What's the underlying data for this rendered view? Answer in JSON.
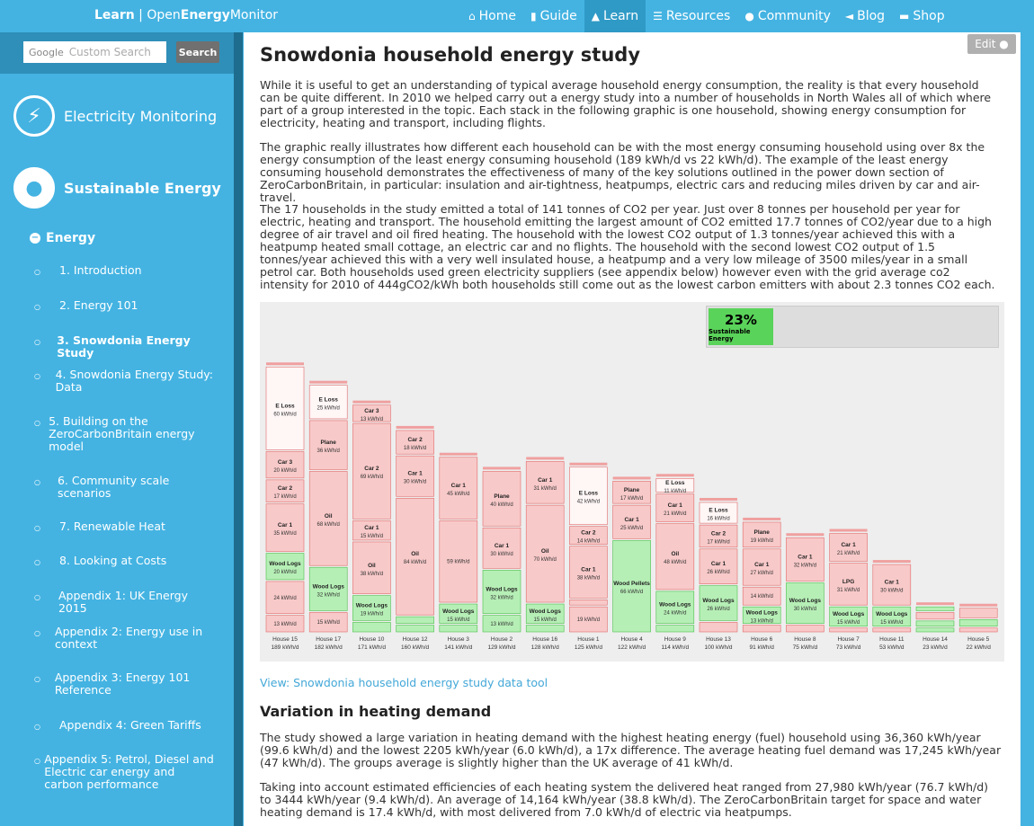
{
  "brand": {
    "learn": "Learn",
    "sep": " | ",
    "open": "Open",
    "energy": "Energy",
    "monitor": "Monitor"
  },
  "nav": [
    {
      "icon": "home-icon",
      "label": "Home",
      "active": false
    },
    {
      "icon": "book-icon",
      "label": "Guide",
      "active": false
    },
    {
      "icon": "graduation-cap-icon",
      "label": "Learn",
      "active": true
    },
    {
      "icon": "list-icon",
      "label": "Resources",
      "active": false
    },
    {
      "icon": "comments-icon",
      "label": "Community",
      "active": false
    },
    {
      "icon": "bullhorn-icon",
      "label": "Blog",
      "active": false
    },
    {
      "icon": "cart-icon",
      "label": "Shop",
      "active": false
    }
  ],
  "search": {
    "google": "Google",
    "placeholder": "Custom Search",
    "button": "Search"
  },
  "sidebar": {
    "cat1": "Electricity Monitoring",
    "cat2": "Sustainable Energy",
    "section": "Energy",
    "items": [
      {
        "label": "1. Introduction"
      },
      {
        "label": "2. Energy 101"
      },
      {
        "label": "3. Snowdonia Energy Study"
      },
      {
        "label": "4. Snowdonia Energy Study: Data"
      },
      {
        "label": "5. Building on the ZeroCarbonBritain energy model"
      },
      {
        "label": "6. Community scale scenarios"
      },
      {
        "label": "7. Renewable Heat"
      },
      {
        "label": "8. Looking at Costs"
      },
      {
        "label": "Appendix 1: UK Energy 2015"
      },
      {
        "label": "Appendix 2: Energy use in context"
      },
      {
        "label": "Appendix 3: Energy 101 Reference"
      },
      {
        "label": "Appendix 4: Green Tariffs"
      },
      {
        "label": "Appendix 5: Petrol, Diesel and Electric car energy and carbon performance"
      }
    ]
  },
  "edit": "Edit",
  "title": "Snowdonia household energy study",
  "p1": "While it is useful to get an understanding of typical average household energy consumption, the reality is that every household can be quite different. In 2010 we helped carry out a energy study into a number of households in North Wales all of which where part of a group interested in the topic. Each stack in the following graphic is one household, showing energy consumption for electricity, heating and transport, including flights.",
  "p2": "The graphic really illustrates how different each household can be with the most energy consuming household using over 8x the energy consumption of the least energy consuming household (189 kWh/d vs 22 kWh/d). The example of the least energy consuming household demonstrates the effectiveness of many of the key solutions outlined in the power down section of ZeroCarbonBritain, in particular: insulation and air-tightness, heatpumps, electric cars and reducing miles driven by car and air-travel.",
  "p3": "The 17 households in the study emitted a total of 141 tonnes of CO2 per year. Just over 8 tonnes per household per year for electric, heating and transport. The household emitting the largest amount of CO2 emitted 17.7 tonnes of CO2/year due to a high degree of air travel and oil fired heating. The household with the lowest CO2 output of 1.3 tonnes/year achieved this with a heatpump heated small cottage, an electric car and no flights. The household with the second lowest CO2 output of 1.5 tonnes/year achieved this with a very well insulated house, a heatpump and a very low mileage of 3500 miles/year in a small petrol car. Both households used green electricity suppliers (see appendix below) however even with the grid average co2 intensity for 2010 of 444gCO2/kWh both households still come out as the lowest carbon emitters with about 2.3 tonnes CO2 each.",
  "datalink": "View: Snowdonia household energy study data tool",
  "h2": "Variation in heating demand",
  "p4": "The study showed a large variation in heating demand with the highest heating energy (fuel) household using 36,360 kWh/year (99.6 kWh/d) and the lowest 2205 kWh/year (6.0 kWh/d), a 17x difference. The average heating fuel demand was 17,245 kWh/year (47 kWh/d). The groups average is slightly higher than the UK average of 41 kWh/d.",
  "p5": "Taking into account estimated efficiencies of each heating system the delivered heat ranged from 27,980 kWh/year (76.7 kWh/d) to 3444 kWh/year (9.4 kWh/d). An average of 14,164 kWh/year (38.8 kWh/d). The ZeroCarbonBritain target for space and water heating demand is 17.4 kWh/d, with most delivered from 7.0 kWh/d of electric via heatpumps.",
  "sustainable": {
    "pct": "23%",
    "label": "Sustainable Energy",
    "fraction": 0.23
  },
  "colors": {
    "red": "#f8c9c9",
    "redborder": "#e26b6b",
    "green": "#b6efb6",
    "greenborder": "#4cbf4c",
    "white": "#fff6f6",
    "top": "#f0a0a0"
  },
  "chart_data": {
    "type": "bar",
    "unit": "kWh/d",
    "households": [
      {
        "name": "House 15",
        "total": "189 kWh/d",
        "total_val": 189,
        "segs": [
          {
            "l": "",
            "v": "13 kWh/d",
            "n": 13,
            "c": "r"
          },
          {
            "l": "",
            "v": "24 kWh/d",
            "n": 24,
            "c": "r"
          },
          {
            "l": "Wood Logs",
            "v": "20 kWh/d",
            "n": 20,
            "c": "g"
          },
          {
            "l": "Car 1",
            "v": "35 kWh/d",
            "n": 35,
            "c": "r"
          },
          {
            "l": "Car 2",
            "v": "17 kWh/d",
            "n": 17,
            "c": "r"
          },
          {
            "l": "Car 3",
            "v": "20 kWh/d",
            "n": 20,
            "c": "r"
          },
          {
            "l": "E Loss",
            "v": "60 kWh/d",
            "n": 60,
            "c": "w"
          }
        ]
      },
      {
        "name": "House 17",
        "total": "182 kWh/d",
        "total_val": 182,
        "segs": [
          {
            "l": "",
            "v": "15 kWh/d",
            "n": 15,
            "c": "r"
          },
          {
            "l": "Wood Logs",
            "v": "32 kWh/d",
            "n": 32,
            "c": "g"
          },
          {
            "l": "Oil",
            "v": "68 kWh/d",
            "n": 68,
            "c": "r"
          },
          {
            "l": "Plane",
            "v": "36 kWh/d",
            "n": 36,
            "c": "r"
          },
          {
            "l": "E Loss",
            "v": "25 kWh/d",
            "n": 25,
            "c": "w"
          }
        ]
      },
      {
        "name": "House 10",
        "total": "171 kWh/d",
        "total_val": 171,
        "segs": [
          {
            "l": "",
            "v": "",
            "n": 8,
            "c": "g"
          },
          {
            "l": "Wood Logs",
            "v": "19 kWh/d",
            "n": 19,
            "c": "g"
          },
          {
            "l": "Oil",
            "v": "38 kWh/d",
            "n": 38,
            "c": "r"
          },
          {
            "l": "Car 1",
            "v": "15 kWh/d",
            "n": 15,
            "c": "r"
          },
          {
            "l": "Car 2",
            "v": "69 kWh/d",
            "n": 69,
            "c": "r"
          },
          {
            "l": "Car 3",
            "v": "13 kWh/d",
            "n": 13,
            "c": "r"
          }
        ]
      },
      {
        "name": "House 12",
        "total": "160 kWh/d",
        "total_val": 160,
        "segs": [
          {
            "l": "",
            "v": "",
            "n": 6,
            "c": "g"
          },
          {
            "l": "",
            "v": "",
            "n": 6,
            "c": "g"
          },
          {
            "l": "Oil",
            "v": "84 kWh/d",
            "n": 84,
            "c": "r"
          },
          {
            "l": "Car 1",
            "v": "30 kWh/d",
            "n": 30,
            "c": "r"
          },
          {
            "l": "Car 2",
            "v": "18 kWh/d",
            "n": 18,
            "c": "r"
          }
        ]
      },
      {
        "name": "House 3",
        "total": "141 kWh/d",
        "total_val": 141,
        "segs": [
          {
            "l": "",
            "v": "",
            "n": 6,
            "c": "g"
          },
          {
            "l": "Wood Logs",
            "v": "15 kWh/d",
            "n": 15,
            "c": "g"
          },
          {
            "l": "",
            "v": "59 kWh/d",
            "n": 59,
            "c": "r"
          },
          {
            "l": "Car 1",
            "v": "45 kWh/d",
            "n": 45,
            "c": "r"
          }
        ]
      },
      {
        "name": "House 2",
        "total": "129 kWh/d",
        "total_val": 129,
        "segs": [
          {
            "l": "",
            "v": "13 kWh/d",
            "n": 13,
            "c": "g"
          },
          {
            "l": "Wood Logs",
            "v": "32 kWh/d",
            "n": 32,
            "c": "g"
          },
          {
            "l": "Car 1",
            "v": "30 kWh/d",
            "n": 30,
            "c": "r"
          },
          {
            "l": "Plane",
            "v": "40 kWh/d",
            "n": 40,
            "c": "r"
          }
        ]
      },
      {
        "name": "House 16",
        "total": "128 kWh/d",
        "total_val": 128,
        "segs": [
          {
            "l": "",
            "v": "",
            "n": 6,
            "c": "g"
          },
          {
            "l": "Wood Logs",
            "v": "15 kWh/d",
            "n": 15,
            "c": "g"
          },
          {
            "l": "Oil",
            "v": "70 kWh/d",
            "n": 70,
            "c": "r"
          },
          {
            "l": "Car 1",
            "v": "31 kWh/d",
            "n": 31,
            "c": "r"
          }
        ]
      },
      {
        "name": "House 1",
        "total": "125 kWh/d",
        "total_val": 125,
        "segs": [
          {
            "l": "",
            "v": "19 kWh/d",
            "n": 19,
            "c": "r"
          },
          {
            "l": "",
            "v": "",
            "n": 5,
            "c": "r"
          },
          {
            "l": "Car 1",
            "v": "38 kWh/d",
            "n": 38,
            "c": "r"
          },
          {
            "l": "Car 2",
            "v": "14 kWh/d",
            "n": 14,
            "c": "r"
          },
          {
            "l": "E Loss",
            "v": "42 kWh/d",
            "n": 42,
            "c": "w"
          }
        ]
      },
      {
        "name": "House 4",
        "total": "122 kWh/d",
        "total_val": 122,
        "segs": [
          {
            "l": "Wood Pellets",
            "v": "66 kWh/d",
            "n": 66,
            "c": "g"
          },
          {
            "l": "Car 1",
            "v": "25 kWh/d",
            "n": 25,
            "c": "r"
          },
          {
            "l": "Plane",
            "v": "17 kWh/d",
            "n": 17,
            "c": "r"
          }
        ]
      },
      {
        "name": "House 9",
        "total": "114 kWh/d",
        "total_val": 114,
        "segs": [
          {
            "l": "",
            "v": "",
            "n": 6,
            "c": "g"
          },
          {
            "l": "Wood Logs",
            "v": "24 kWh/d",
            "n": 24,
            "c": "g"
          },
          {
            "l": "Oil",
            "v": "48 kWh/d",
            "n": 48,
            "c": "r"
          },
          {
            "l": "Car 1",
            "v": "21 kWh/d",
            "n": 21,
            "c": "r"
          },
          {
            "l": "E Loss",
            "v": "11 kWh/d",
            "n": 11,
            "c": "w"
          }
        ]
      },
      {
        "name": "House 13",
        "total": "100 kWh/d",
        "total_val": 100,
        "segs": [
          {
            "l": "",
            "v": "",
            "n": 8,
            "c": "r"
          },
          {
            "l": "Wood Logs",
            "v": "26 kWh/d",
            "n": 26,
            "c": "g"
          },
          {
            "l": "Car 1",
            "v": "26 kWh/d",
            "n": 26,
            "c": "r"
          },
          {
            "l": "Car 2",
            "v": "17 kWh/d",
            "n": 17,
            "c": "r"
          },
          {
            "l": "E Loss",
            "v": "16 kWh/d",
            "n": 16,
            "c": "w"
          }
        ]
      },
      {
        "name": "House 6",
        "total": "91 kWh/d",
        "total_val": 91,
        "segs": [
          {
            "l": "",
            "v": "",
            "n": 6,
            "c": "r"
          },
          {
            "l": "Wood Logs",
            "v": "13 kWh/d",
            "n": 13,
            "c": "g"
          },
          {
            "l": "",
            "v": "14 kWh/d",
            "n": 14,
            "c": "r"
          },
          {
            "l": "Car 1",
            "v": "27 kWh/d",
            "n": 27,
            "c": "r"
          },
          {
            "l": "Plane",
            "v": "19 kWh/d",
            "n": 19,
            "c": "r"
          }
        ]
      },
      {
        "name": "House 8",
        "total": "75 kWh/d",
        "total_val": 75,
        "segs": [
          {
            "l": "",
            "v": "",
            "n": 6,
            "c": "r"
          },
          {
            "l": "Wood Logs",
            "v": "30 kWh/d",
            "n": 30,
            "c": "g"
          },
          {
            "l": "Car 1",
            "v": "32 kWh/d",
            "n": 32,
            "c": "r"
          }
        ]
      },
      {
        "name": "House 7",
        "total": "73 kWh/d",
        "total_val": 73,
        "segs": [
          {
            "l": "",
            "v": "",
            "n": 4,
            "c": "r"
          },
          {
            "l": "Wood Logs",
            "v": "15 kWh/d",
            "n": 15,
            "c": "g"
          },
          {
            "l": "LPG",
            "v": "31 kWh/d",
            "n": 31,
            "c": "r"
          },
          {
            "l": "Car 1",
            "v": "21 kWh/d",
            "n": 21,
            "c": "r"
          }
        ]
      },
      {
        "name": "House 11",
        "total": "53 kWh/d",
        "total_val": 53,
        "segs": [
          {
            "l": "",
            "v": "",
            "n": 4,
            "c": "r"
          },
          {
            "l": "Wood Logs",
            "v": "15 kWh/d",
            "n": 15,
            "c": "g"
          },
          {
            "l": "Car 1",
            "v": "30 kWh/d",
            "n": 30,
            "c": "r"
          }
        ]
      },
      {
        "name": "House 14",
        "total": "23 kWh/d",
        "total_val": 23,
        "segs": [
          {
            "l": "",
            "v": "",
            "n": 4,
            "c": "g"
          },
          {
            "l": "",
            "v": "",
            "n": 5,
            "c": "g"
          },
          {
            "l": "",
            "v": "",
            "n": 6,
            "c": "r"
          },
          {
            "l": "",
            "v": "",
            "n": 4,
            "c": "g"
          }
        ]
      },
      {
        "name": "House 5",
        "total": "22 kWh/d",
        "total_val": 22,
        "segs": [
          {
            "l": "",
            "v": "",
            "n": 4,
            "c": "r"
          },
          {
            "l": "",
            "v": "",
            "n": 6,
            "c": "g"
          },
          {
            "l": "",
            "v": "",
            "n": 8,
            "c": "r"
          }
        ]
      }
    ]
  }
}
